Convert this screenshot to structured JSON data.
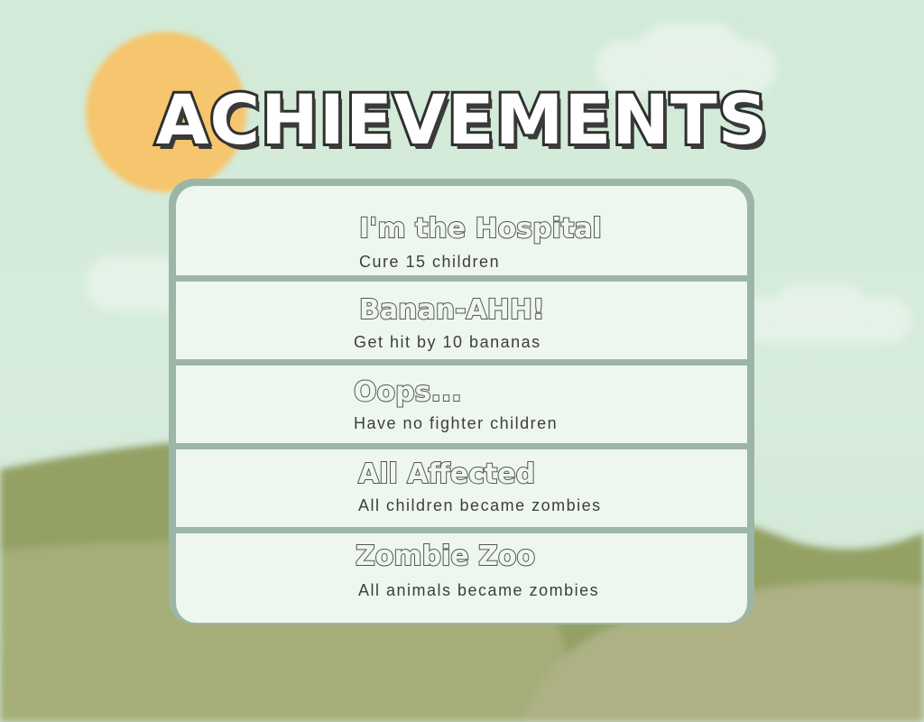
{
  "screen": {
    "title": "ACHIEVEMENTS"
  },
  "achievements": [
    {
      "title": "I'm the Hospital",
      "description": "Cure 15 children"
    },
    {
      "title": "Banan-AHH!",
      "description": "Get hit by 10 bananas"
    },
    {
      "title": "Oops...",
      "description": "Have no fighter children"
    },
    {
      "title": "All Affected",
      "description": "All children became zombies"
    },
    {
      "title": "Zombie Zoo",
      "description": "All animals became zombies"
    }
  ],
  "colors": {
    "sky": "#d2ead8",
    "sun": "#f5c66e",
    "hill_dark": "#8d9c5f",
    "hill_light": "#a7b07c",
    "panel_border": "#9bb6a6",
    "row_fill": "#eef7ee"
  }
}
